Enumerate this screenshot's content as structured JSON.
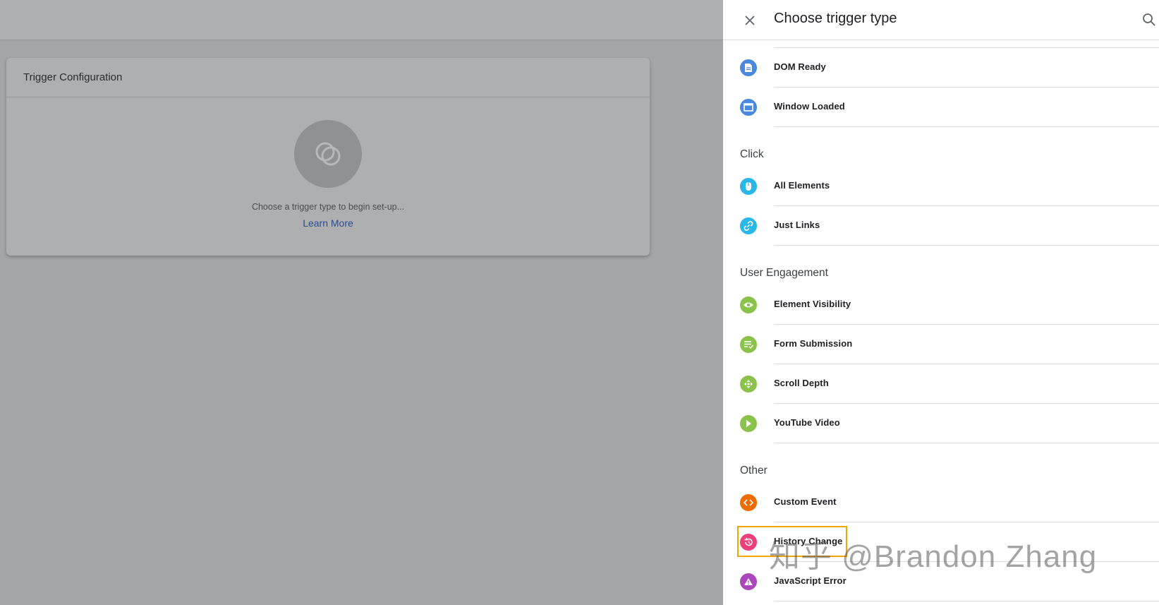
{
  "config": {
    "title": "Trigger Configuration",
    "hint": "Choose a trigger type to begin set-up...",
    "learn_more": "Learn More"
  },
  "panel": {
    "title": "Choose trigger type"
  },
  "sections": [
    {
      "title": "",
      "items": [
        {
          "label": "DOM Ready",
          "icon": "document-icon",
          "color": "#4a89dc"
        },
        {
          "label": "Window Loaded",
          "icon": "window-icon",
          "color": "#4a89dc"
        }
      ]
    },
    {
      "title": "Click",
      "items": [
        {
          "label": "All Elements",
          "icon": "mouse-icon",
          "color": "#29b6e8"
        },
        {
          "label": "Just Links",
          "icon": "link-icon",
          "color": "#29b6e8"
        }
      ]
    },
    {
      "title": "User Engagement",
      "items": [
        {
          "label": "Element Visibility",
          "icon": "eye-icon",
          "color": "#8bc34a"
        },
        {
          "label": "Form Submission",
          "icon": "form-icon",
          "color": "#8bc34a"
        },
        {
          "label": "Scroll Depth",
          "icon": "scroll-icon",
          "color": "#8bc34a"
        },
        {
          "label": "YouTube Video",
          "icon": "play-icon",
          "color": "#8bc34a"
        }
      ]
    },
    {
      "title": "Other",
      "items": [
        {
          "label": "Custom Event",
          "icon": "code-icon",
          "color": "#ef6c00"
        },
        {
          "label": "History Change",
          "icon": "history-icon",
          "color": "#ec407a"
        },
        {
          "label": "JavaScript Error",
          "icon": "warning-icon",
          "color": "#ab47bc"
        }
      ]
    }
  ],
  "watermark": "知乎 @Brandon Zhang",
  "colors": {
    "highlight": "#f0a500",
    "link": "#2c4f8c"
  }
}
